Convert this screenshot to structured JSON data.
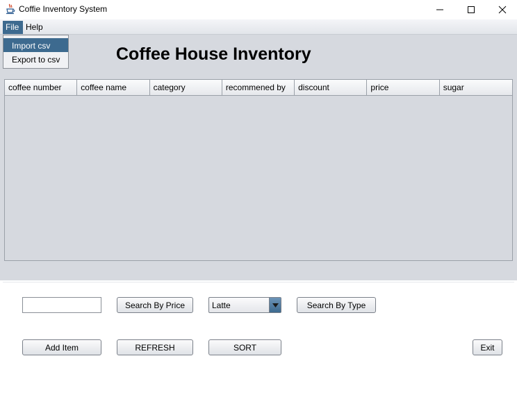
{
  "window": {
    "title": "Coffie Inventory System",
    "icon": "java-cup-icon",
    "controls": [
      "minimize-icon",
      "maximize-icon",
      "close-icon"
    ]
  },
  "menubar": {
    "file": "File",
    "help": "Help"
  },
  "file_menu": {
    "items": [
      "Import csv",
      "Export to csv"
    ],
    "highlighted": "Import csv"
  },
  "main": {
    "title": "Coffee House Inventory"
  },
  "table": {
    "columns": [
      "coffee number",
      "coffee name",
      "category",
      "recommened by",
      "discount",
      "price",
      "sugar"
    ],
    "rows": []
  },
  "controls": {
    "search_input_value": "",
    "search_by_price": "Search By Price",
    "type_select_value": "Latte",
    "search_by_type": "Search By Type",
    "add_item": "Add Item",
    "refresh": "REFRESH",
    "sort": "SORT",
    "exit": "Exit"
  },
  "colors": {
    "accent": "#3d6a8f",
    "panel_bg": "#d6d9df"
  }
}
